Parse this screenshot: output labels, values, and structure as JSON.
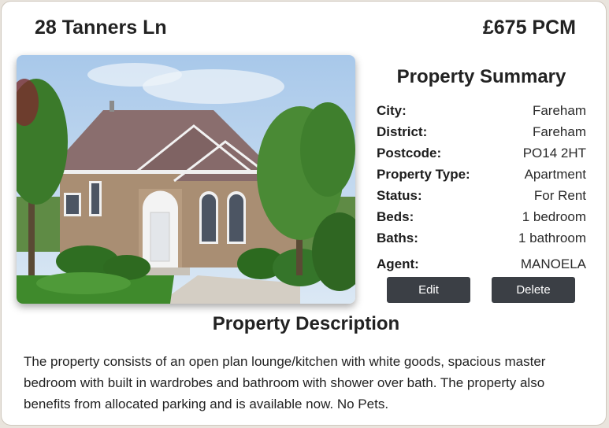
{
  "listing": {
    "address": "28 Tanners Ln",
    "price": "£675 PCM"
  },
  "photo": {
    "subject": "brick bungalow house with garden",
    "colors": {
      "sky": "#b8d4ee",
      "roof": "#8a6e6e",
      "brick": "#a98e73",
      "grass": "#3f8a2c",
      "tree": "#3b7a2a"
    }
  },
  "summary": {
    "title": "Property Summary",
    "fields": [
      {
        "label": "City:",
        "value": "Fareham"
      },
      {
        "label": "District:",
        "value": "Fareham"
      },
      {
        "label": "Postcode:",
        "value": "PO14 2HT"
      },
      {
        "label": "Property Type:",
        "value": "Apartment"
      },
      {
        "label": "Status:",
        "value": "For Rent"
      },
      {
        "label": "Beds:",
        "value": "1 bedroom"
      },
      {
        "label": "Baths:",
        "value": "1 bathroom"
      }
    ],
    "agent": {
      "label": "Agent:",
      "value": "MANOELA"
    }
  },
  "actions": {
    "edit_label": "Edit",
    "delete_label": "Delete",
    "button_color": "#3b3f45"
  },
  "description": {
    "title": "Property Description",
    "text": "The property consists of an open plan lounge/kitchen with white goods, spacious master bedroom with built in wardrobes and bathroom with shower over bath. The property also benefits from allocated parking and is available now. No Pets."
  }
}
